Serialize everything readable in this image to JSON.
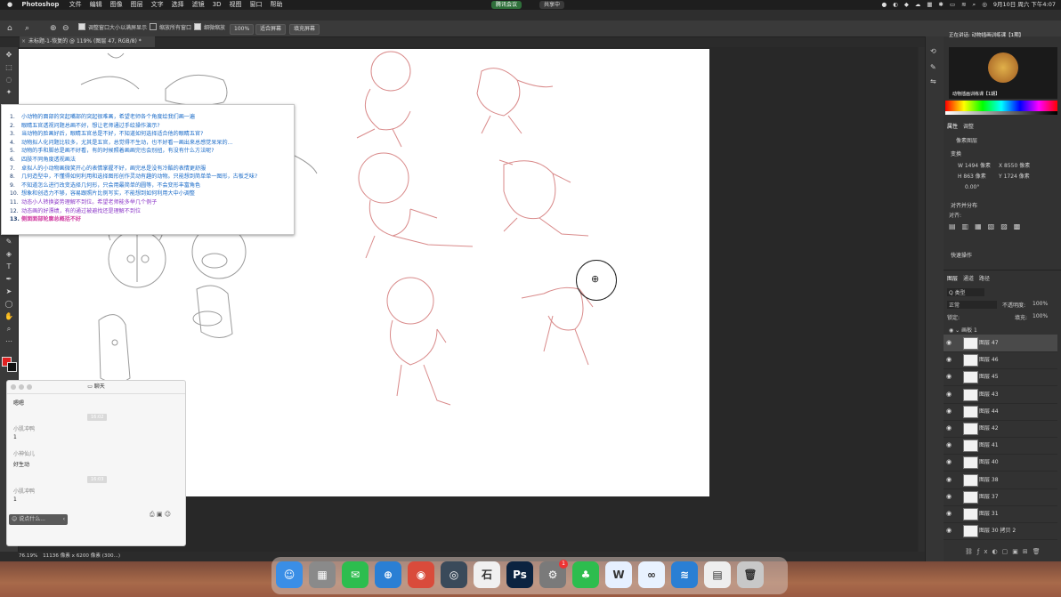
{
  "menubar": {
    "app_name": "Photoshop",
    "menus": [
      "文件",
      "编辑",
      "图像",
      "图层",
      "文字",
      "选择",
      "滤镜",
      "3D",
      "视图",
      "窗口",
      "帮助"
    ],
    "meeting_label": "腾讯会议",
    "sharing_label": "共享中",
    "clock": "9月10日 周六 下午4:07"
  },
  "options_bar": {
    "resize_window_label": "调整窗口大小以满屏显示",
    "zoom_all_label": "缩放所有窗口",
    "scrubby_zoom_label": "细微缩放",
    "zoom_percent": "100%",
    "fit_screen_label": "适合屏幕",
    "fill_screen_label": "填充屏幕"
  },
  "document_tab": {
    "title": "未标题-1-恢复的 @ 119% (图层 47, RGB/8) *"
  },
  "questions": [
    {
      "num": "1.",
      "text": "小动物的面部的突起嘴部的突起很难画，希望老师各个角度绘我们画一遍"
    },
    {
      "num": "2.",
      "text": "眼睛五官透视问题总画不好，想让老师通过手绘操作演示?"
    },
    {
      "num": "3.",
      "text": "当动物的脸画好后，眼睛五官总是不好，不知道如何选择适合他的眼睛五官?"
    },
    {
      "num": "4.",
      "text": "动物拟人化问题比较多，尤其是五官，总觉得不生动，也不好看一画出来总感觉呆呆的..."
    },
    {
      "num": "5.",
      "text": "动物的手和脚总是画不好看，有的时候照着画画完也会别扭，有没有什么方法呢?"
    },
    {
      "num": "6.",
      "text": "四肢不同角度透视画法"
    },
    {
      "num": "7.",
      "text": "卓拟人的小动物画微笑开心的表情掌握不好，画完总是没有冷酷的表情更舒服"
    },
    {
      "num": "8.",
      "text": "几何造型中，不懂得如何利用和选择图形创作灵动有趣的动物。只能想到简单单一图形，古板乏味?"
    },
    {
      "num": "9.",
      "text": "不知道怎么进行改变选择几何形，只会用最简单的圆等，不会变形丰富角色"
    },
    {
      "num": "10.",
      "text": "想象和创造力不够，容易跟照片比例写实，不能想到如何利用大中小调整"
    },
    {
      "num": "11.",
      "text": "动态小人转换姿势理解不到位。希望老师能多举几个例子"
    },
    {
      "num": "12.",
      "text": "动态画的好漂绩，有的通过被避找还是理解不到位"
    },
    {
      "num": "13.",
      "text": "侧面面部轮廓总概括不好"
    }
  ],
  "chat": {
    "title": "聊天",
    "messages": [
      {
        "kind": "text",
        "text": "嗯嗯"
      },
      {
        "kind": "time",
        "text": "16:02"
      },
      {
        "kind": "sender",
        "text": "小肌冲鸭"
      },
      {
        "kind": "text",
        "text": "1"
      },
      {
        "kind": "sender",
        "text": "小神仙儿"
      },
      {
        "kind": "text",
        "text": "好生动"
      },
      {
        "kind": "time",
        "text": "16:03"
      },
      {
        "kind": "sender",
        "text": "小肌冲鸭"
      },
      {
        "kind": "text",
        "text": "1"
      }
    ],
    "input_placeholder": "说点什么..."
  },
  "status_bar": {
    "zoom": "76.19%",
    "doc_size": "11136 像素 x 6200 像素 (300...)"
  },
  "right_panel": {
    "video_title": "正在讲话: 动物插画训练课【1期】",
    "video_caption": "动物插画训练课【1期】",
    "tabs_properties": [
      "属性",
      "调整"
    ],
    "pixel_layer_label": "像素图层",
    "transform_title": "变换",
    "w_value": "W 1494 像素",
    "h_value": "H 863 像素",
    "x_value": "X 8550 像素",
    "y_value": "Y 1724 像素",
    "angle_value": "0.00°",
    "align_title": "对齐并分布",
    "align_label": "对齐:",
    "quick_actions_title": "快速操作",
    "layer_tabs": [
      "图层",
      "通道",
      "路径"
    ],
    "kind_label": "Q 类型",
    "blend_mode": "正常",
    "opacity_label": "不透明度:",
    "opacity_value": "100%",
    "lock_label": "锁定:",
    "fill_label": "填充:",
    "fill_value": "100%",
    "group_name": "画板 1",
    "layers": [
      "图层 47",
      "图层 46",
      "图层 45",
      "图层 43",
      "图层 44",
      "图层 42",
      "图层 41",
      "图层 40",
      "图层 38",
      "图层 37",
      "图层 31",
      "图层 30 拷贝 2"
    ],
    "selected_layer": "图层 47"
  },
  "dock": {
    "apps": [
      {
        "name": "finder",
        "glyph": "☺",
        "color": "#3a8ee6"
      },
      {
        "name": "launchpad",
        "glyph": "▦",
        "color": "#8a8a8a"
      },
      {
        "name": "wechat",
        "glyph": "✉",
        "color": "#2dbd4e"
      },
      {
        "name": "safari",
        "glyph": "⊕",
        "color": "#2a7fd4"
      },
      {
        "name": "chrome",
        "glyph": "◉",
        "color": "#d94b3b"
      },
      {
        "name": "quicktime",
        "glyph": "◎",
        "color": "#3a4a5a"
      },
      {
        "name": "shimo",
        "glyph": "石",
        "color": "#f0f0f0"
      },
      {
        "name": "photoshop",
        "glyph": "Ps",
        "color": "#0b2340"
      },
      {
        "name": "system-preferences",
        "glyph": "⚙",
        "color": "#7a7a7a"
      },
      {
        "name": "evernote",
        "glyph": "♣",
        "color": "#2dbd4e"
      },
      {
        "name": "wps",
        "glyph": "W",
        "color": "#e6f0ff"
      },
      {
        "name": "baidu-netdisk",
        "glyph": "∞",
        "color": "#e8f2ff"
      },
      {
        "name": "feishu",
        "glyph": "≋",
        "color": "#2a7fd4"
      },
      {
        "name": "preview",
        "glyph": "▤",
        "color": "#eeeeee"
      },
      {
        "name": "trash",
        "glyph": "🗑",
        "color": "#c8c8c8"
      }
    ],
    "badge": "1"
  }
}
